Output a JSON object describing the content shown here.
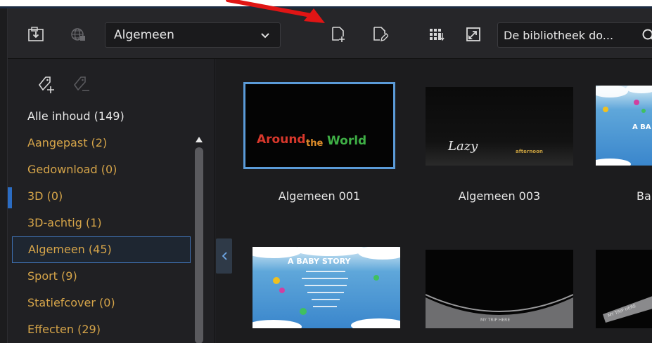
{
  "toolbar": {
    "icons": [
      "import-icon",
      "globe-icon",
      "new-template-icon",
      "edit-template-icon",
      "grid-view-icon",
      "fullscreen-icon"
    ],
    "category_select": {
      "value": "Algemeen"
    },
    "search": {
      "value": "De bibliotheek do..."
    }
  },
  "sidebar": {
    "tag_icons": [
      "add-tag-icon",
      "remove-tag-icon"
    ],
    "items": [
      {
        "label": "Alle inhoud (149)"
      },
      {
        "label": "Aangepast  (2)"
      },
      {
        "label": "Gedownload  (0)"
      },
      {
        "label": "3D  (0)"
      },
      {
        "label": "3D-achtig  (1)"
      },
      {
        "label": "Algemeen  (45)"
      },
      {
        "label": "Sport  (9)"
      },
      {
        "label": "Statiefcover  (0)"
      },
      {
        "label": "Effecten  (29)"
      }
    ],
    "selected_index": 5
  },
  "library": {
    "items": [
      {
        "caption": "Algemeen 001",
        "thumb_text": "Around the World"
      },
      {
        "caption": "Algemeen 003",
        "thumb_text": "Lazy",
        "thumb_subtext": "afternoon"
      },
      {
        "caption": "Ba",
        "thumb_text": "A BA"
      },
      {
        "caption": "",
        "thumb_text": "A BABY STORY"
      },
      {
        "caption": "",
        "thumb_text": "MY TRIP HERE"
      },
      {
        "caption": "",
        "thumb_text": "MY TRIP HERE"
      }
    ]
  },
  "colors": {
    "accent_blue": "#5b9bd8",
    "category_orange": "#d5a449",
    "annotation_red": "#e01515"
  }
}
